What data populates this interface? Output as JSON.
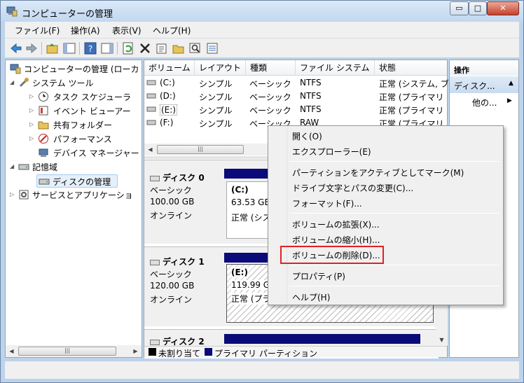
{
  "window": {
    "title": "コンピューターの管理",
    "controls": {
      "minimize": "▭",
      "maximize": "□",
      "close": "✕"
    }
  },
  "menubar": [
    "ファイル(F)",
    "操作(A)",
    "表示(V)",
    "ヘルプ(H)"
  ],
  "tree": {
    "root": "コンピューターの管理 (ローカ",
    "system_tools": "システム ツール",
    "task_scheduler": "タスク スケジューラ",
    "event_viewer": "イベント ビューアー",
    "shared_folders": "共有フォルダー",
    "performance": "パフォーマンス",
    "device_manager": "デバイス マネージャー",
    "storage": "記憶域",
    "disk_management": "ディスクの管理",
    "services": "サービスとアプリケーショ"
  },
  "volume_list": {
    "columns": [
      "ボリューム",
      "レイアウト",
      "種類",
      "ファイル システム",
      "状態"
    ],
    "rows": [
      {
        "volume": "(C:)",
        "layout": "シンプル",
        "type": "ベーシック",
        "fs": "NTFS",
        "status": "正常 (システム, ブ"
      },
      {
        "volume": "(D:)",
        "layout": "シンプル",
        "type": "ベーシック",
        "fs": "NTFS",
        "status": "正常 (プライマリ"
      },
      {
        "volume": "(E:)",
        "layout": "シンプル",
        "type": "ベーシック",
        "fs": "NTFS",
        "status": "正常 (プライマリ"
      },
      {
        "volume": "(F:)",
        "layout": "シンプル",
        "type": "ベーシック",
        "fs": "RAW",
        "status": "正常 (プライマリ"
      }
    ]
  },
  "disks": [
    {
      "name": "ディスク 0",
      "kind": "ベーシック",
      "size": "100.00 GB",
      "state": "オンライン",
      "partition": {
        "label": "(C:)",
        "size": "63.53 GB",
        "status": "正常 (シス"
      }
    },
    {
      "name": "ディスク 1",
      "kind": "ベーシック",
      "size": "120.00 GB",
      "state": "オンライン",
      "partition": {
        "label": "(E:)",
        "size": "119.99 G",
        "status": "正常 (プラ"
      }
    },
    {
      "name": "ディスク 2"
    }
  ],
  "legend": {
    "unallocated": "未割り当て",
    "primary": "プライマリ パーティション"
  },
  "actions": {
    "header": "操作",
    "item": "ディスク...",
    "more": "他の..."
  },
  "context_menu": {
    "open": "開く(O)",
    "explore": "エクスプローラー(E)",
    "mark_active": "パーティションをアクティブとしてマーク(M)",
    "change_letter": "ドライブ文字とパスの変更(C)...",
    "format": "フォーマット(F)...",
    "extend": "ボリュームの拡張(X)...",
    "shrink": "ボリュームの縮小(H)...",
    "delete": "ボリュームの削除(D)...",
    "properties": "プロパティ(P)",
    "help": "ヘルプ(H)"
  },
  "colors": {
    "accent": "#0a0a78",
    "highlight": "#e32222",
    "unallocated": "#000000"
  }
}
